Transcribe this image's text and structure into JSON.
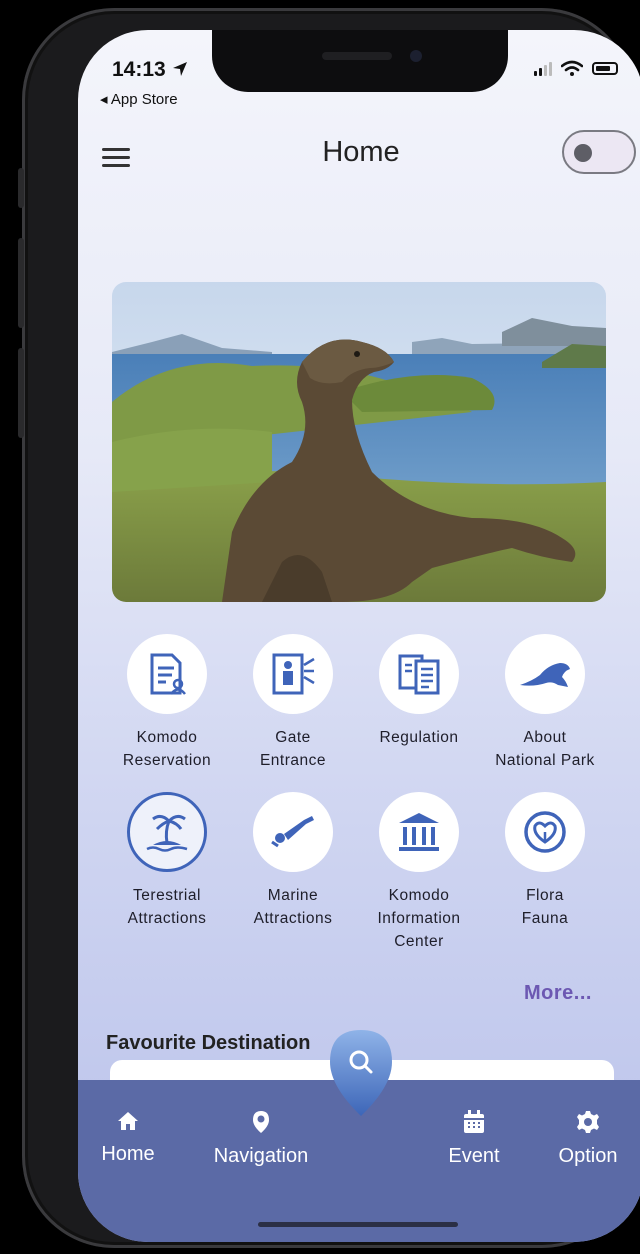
{
  "status_bar": {
    "time": "14:13",
    "back_label": "◂ App Store"
  },
  "header": {
    "title": "Home",
    "dark_mode_toggle": "off"
  },
  "menu_items": [
    {
      "label": "Komodo\nReservation",
      "icon": "reservation-document-icon"
    },
    {
      "label": "Gate\nEntrance",
      "icon": "gate-entrance-icon"
    },
    {
      "label": "Regulation",
      "icon": "regulation-documents-icon"
    },
    {
      "label": "About\nNational Park",
      "icon": "komodo-lizard-icon"
    },
    {
      "label": "Terestrial\nAttractions",
      "icon": "island-palm-icon"
    },
    {
      "label": "Marine\nAttractions",
      "icon": "diver-icon"
    },
    {
      "label": "Komodo\nInformation\nCenter",
      "icon": "institution-building-icon"
    },
    {
      "label": "Flora\nFauna",
      "icon": "leaf-heart-icon"
    }
  ],
  "more_label": "More...",
  "favourite": {
    "title": "Favourite Destination"
  },
  "bottom_nav": {
    "items": [
      {
        "label": "Home",
        "icon": "home-icon"
      },
      {
        "label": "Navigation",
        "icon": "location-pin-icon"
      },
      {
        "label": "Event",
        "icon": "calendar-icon"
      },
      {
        "label": "Option",
        "icon": "gear-icon"
      }
    ],
    "center_button_icon": "search-icon"
  },
  "colors": {
    "accent": "#3f64b9",
    "nav_bar": "#5b6aa6",
    "more_link": "#6c58b2"
  }
}
